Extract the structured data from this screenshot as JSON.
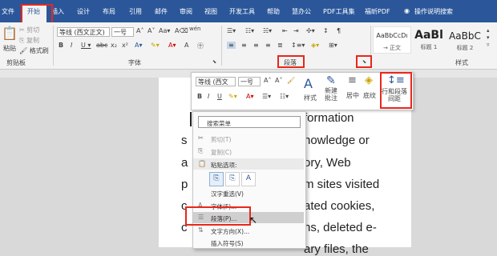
{
  "tabs": [
    "文件",
    "开始",
    "插入",
    "设计",
    "布局",
    "引用",
    "邮件",
    "审阅",
    "视图",
    "开发工具",
    "帮助",
    "慧办公",
    "PDF工具集",
    "福昕PDF",
    "操作说明搜索"
  ],
  "clipboard": {
    "cut": "剪切",
    "copy": "复制",
    "format_painter": "格式刷",
    "paste": "粘贴",
    "group": "剪贴板"
  },
  "font": {
    "name": "等线 (西文正文)",
    "size": "一号",
    "group": "字体",
    "wen": "wén"
  },
  "paragraph": {
    "group": "段落"
  },
  "styles": {
    "items": [
      {
        "preview": "AaBbCcDı",
        "name": "→ 正文"
      },
      {
        "preview": "AaBl",
        "name": "标题 1"
      },
      {
        "preview": "AaBbC",
        "name": "标题 2"
      }
    ],
    "group": "样式"
  },
  "minibar": {
    "font": "等线 (西文",
    "size": "一号",
    "styles": "样式",
    "new_comment_line1": "新建",
    "new_comment_line2": "批注",
    "center": "居中",
    "shading": "底纹",
    "line_spacing_line1": "行和段落",
    "line_spacing_line2": "间距"
  },
  "context_menu": {
    "search_placeholder": "搜索菜单",
    "cut": "剪切(T)",
    "copy": "复制(C)",
    "paste_options": "粘贴选项:",
    "reconvert": "汉字重选(V)",
    "font": "字体(F)...",
    "paragraph": "段落(P)...",
    "text_direction": "文字方向(X)...",
    "insert_symbol": "插入符号(S)"
  },
  "document": {
    "lines": [
      "formation",
      "nowledge or",
      "ory, Web",
      "m sites visited",
      "ated cookies,",
      "ns, deleted e-",
      "ary files, the"
    ],
    "left_chars": [
      "",
      "s",
      "a",
      "p",
      "c",
      "c",
      ""
    ]
  }
}
